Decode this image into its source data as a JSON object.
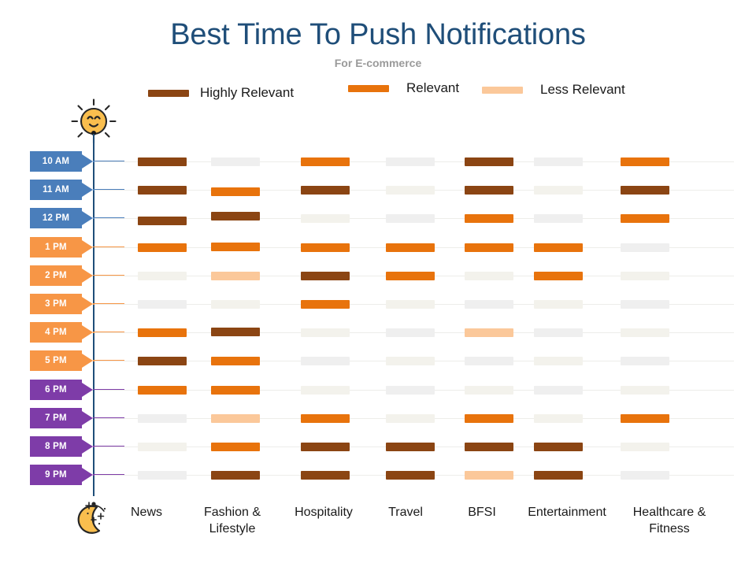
{
  "chart_data": {
    "type": "heatmap",
    "title": "Best Time To Push Notifications",
    "subtitle": "For E-commerce",
    "xlabel": "",
    "ylabel": "",
    "grid": true,
    "legend_position": "top",
    "legend": [
      {
        "label": "Highly Relevant",
        "color": "#8B4513",
        "level": 3
      },
      {
        "label": "Relevant",
        "color": "#E8730C",
        "level": 2
      },
      {
        "label": "Less Relevant",
        "color": "#FBC89A",
        "level": 1
      }
    ],
    "level_colors": {
      "3": "#8B4513",
      "2": "#E8730C",
      "1": "#FBC89A",
      "0": "#F3F2EC",
      "0b": "#EFEFEF"
    },
    "categories": [
      "News",
      "Fashion & Lifestyle",
      "Hospitality",
      "Travel",
      "BFSI",
      "Entertainment",
      "Healthcare & Fitness"
    ],
    "times": [
      {
        "label": "10 AM",
        "color": "#4A7EBB"
      },
      {
        "label": "11 AM",
        "color": "#4A7EBB"
      },
      {
        "label": "12 PM",
        "color": "#4A7EBB"
      },
      {
        "label": "1 PM",
        "color": "#F79646"
      },
      {
        "label": "2 PM",
        "color": "#F79646"
      },
      {
        "label": "3 PM",
        "color": "#F79646"
      },
      {
        "label": "4 PM",
        "color": "#F79646"
      },
      {
        "label": "5 PM",
        "color": "#F79646"
      },
      {
        "label": "6 PM",
        "color": "#7E3CA8"
      },
      {
        "label": "7 PM",
        "color": "#7E3CA8"
      },
      {
        "label": "8 PM",
        "color": "#7E3CA8"
      },
      {
        "label": "9 PM",
        "color": "#7E3CA8"
      }
    ],
    "rows": [
      {
        "time": "10 AM",
        "values": [
          3,
          0,
          2,
          0,
          3,
          0,
          2
        ],
        "offsets": [
          0,
          0,
          0,
          0,
          0,
          0,
          0
        ]
      },
      {
        "time": "11 AM",
        "values": [
          3,
          2,
          3,
          0,
          3,
          0,
          3
        ],
        "offsets": [
          0,
          2,
          0,
          0,
          0,
          0,
          0
        ]
      },
      {
        "time": "12 PM",
        "values": [
          3,
          3,
          0,
          0,
          2,
          0,
          2
        ],
        "offsets": [
          3,
          -3,
          0,
          0,
          0,
          0,
          0
        ]
      },
      {
        "time": "1 PM",
        "values": [
          2,
          2,
          2,
          2,
          2,
          2,
          0
        ],
        "offsets": [
          0,
          -1,
          0,
          0,
          0,
          0,
          0
        ]
      },
      {
        "time": "2 PM",
        "values": [
          0,
          1,
          3,
          2,
          0,
          2,
          0
        ],
        "offsets": [
          0,
          0,
          0,
          0,
          0,
          0,
          0
        ]
      },
      {
        "time": "3 PM",
        "values": [
          0,
          0,
          2,
          0,
          0,
          0,
          0
        ],
        "offsets": [
          0,
          0,
          0,
          0,
          0,
          0,
          0
        ]
      },
      {
        "time": "4 PM",
        "values": [
          2,
          3,
          0,
          0,
          1,
          0,
          0
        ],
        "offsets": [
          0,
          -1,
          0,
          0,
          0,
          0,
          0
        ]
      },
      {
        "time": "5 PM",
        "values": [
          3,
          2,
          0,
          0,
          0,
          0,
          0
        ],
        "offsets": [
          0,
          0,
          0,
          0,
          0,
          0,
          0
        ]
      },
      {
        "time": "6 PM",
        "values": [
          2,
          2,
          0,
          0,
          0,
          0,
          0
        ],
        "offsets": [
          0,
          0,
          0,
          0,
          0,
          0,
          0
        ]
      },
      {
        "time": "7 PM",
        "values": [
          0,
          1,
          2,
          0,
          2,
          0,
          2
        ],
        "offsets": [
          0,
          0,
          0,
          0,
          0,
          0,
          0
        ]
      },
      {
        "time": "8 PM",
        "values": [
          0,
          2,
          3,
          3,
          3,
          3,
          0
        ],
        "offsets": [
          0,
          0,
          0,
          0,
          0,
          0,
          0
        ]
      },
      {
        "time": "9 PM",
        "values": [
          0,
          3,
          3,
          3,
          1,
          3,
          0
        ],
        "offsets": [
          0,
          0,
          0,
          0,
          0,
          0,
          0
        ]
      }
    ],
    "icons": {
      "start": "sun-icon",
      "end": "moon-icon"
    }
  },
  "theme": {
    "title_color": "#1F4E79",
    "subtitle_color": "#9A9A9A",
    "axis_color": "#1F4E79",
    "gridline_color": "#EDEDEA"
  }
}
